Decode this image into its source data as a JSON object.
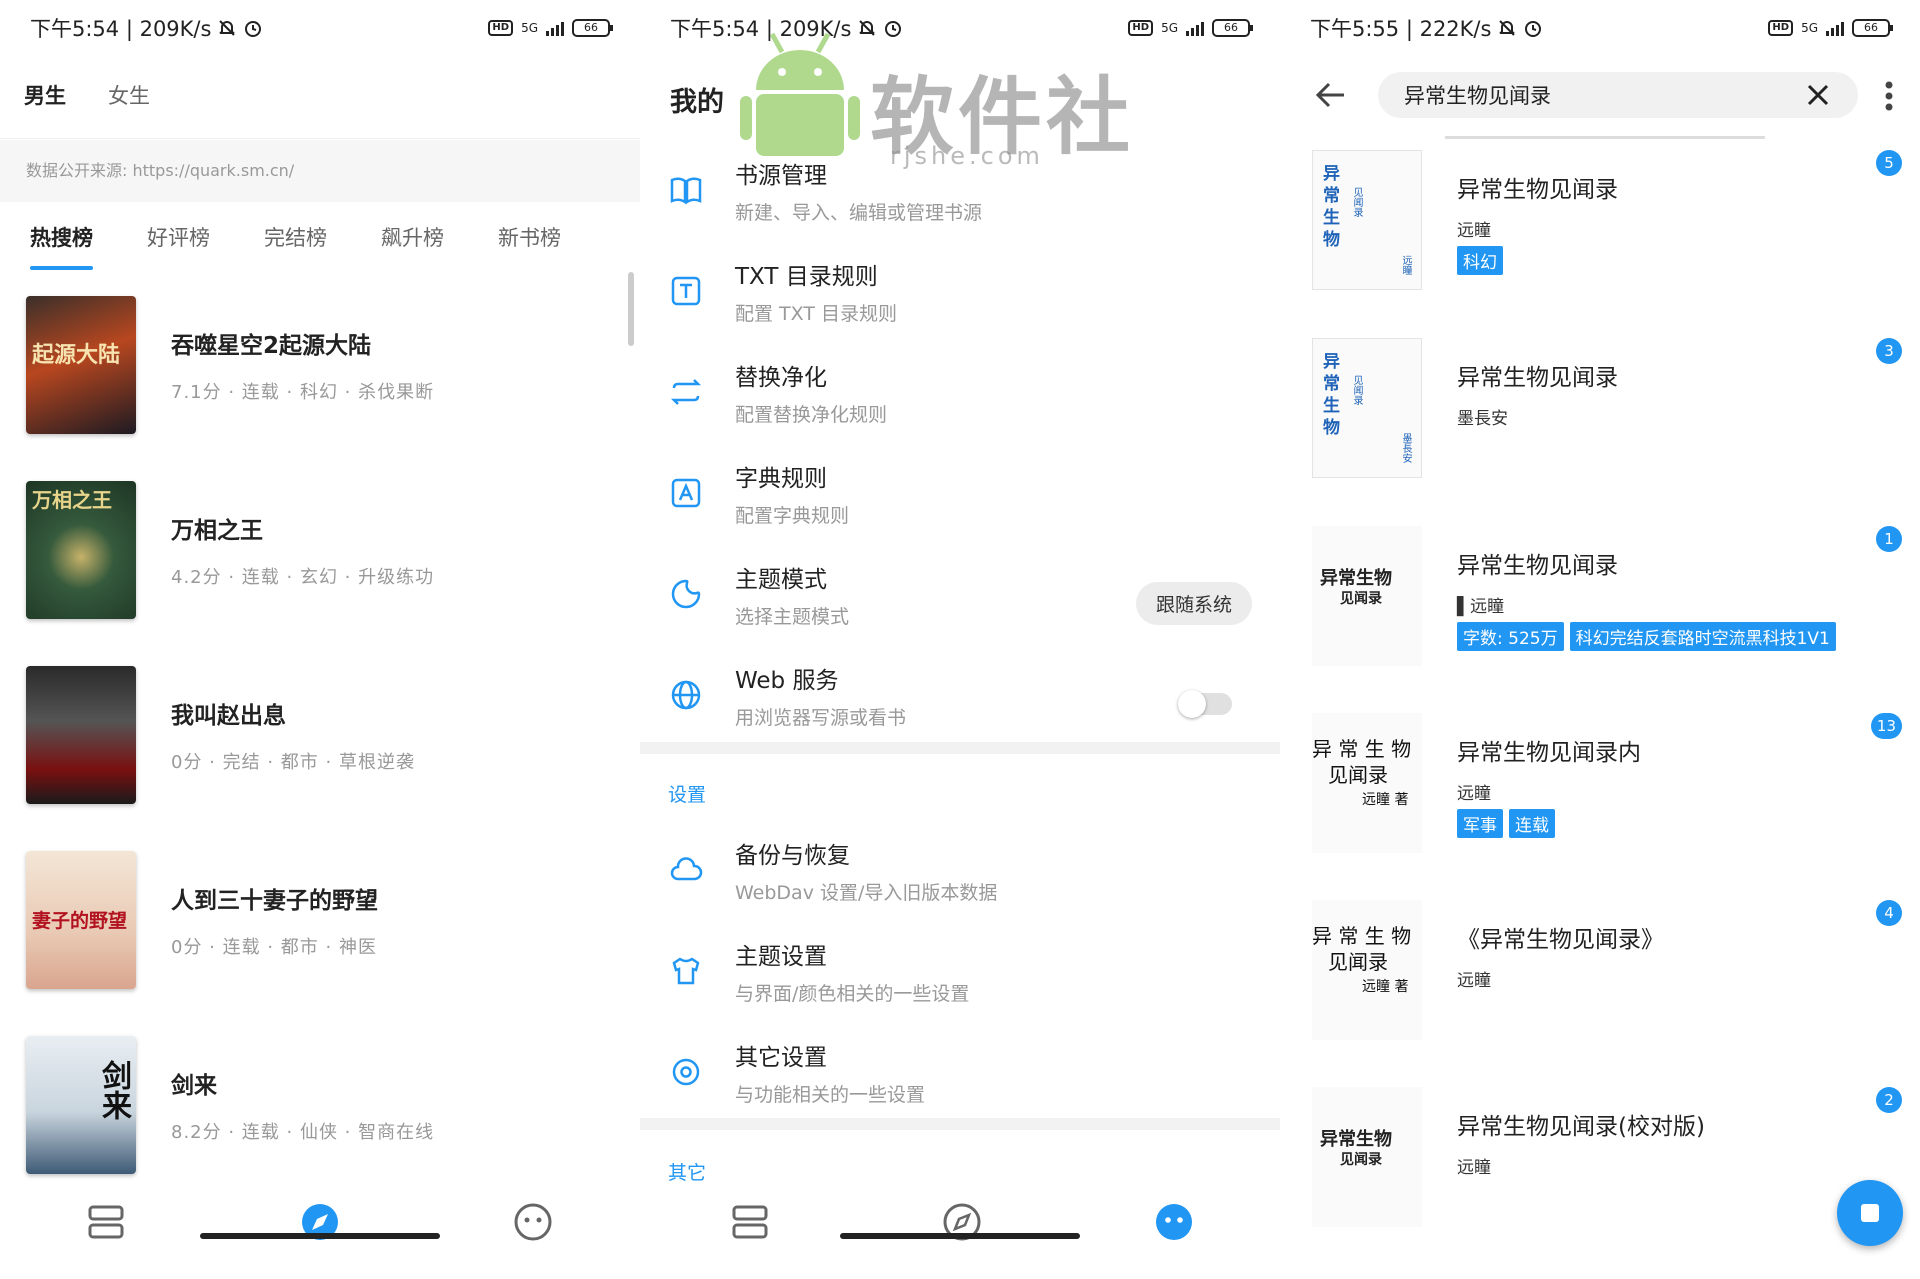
{
  "colors": {
    "accent": "#2196f3",
    "text": "#222222",
    "muted": "#999999"
  },
  "panel1": {
    "status": {
      "time": "下午5:54 | 209K/s",
      "battery": "66",
      "network": "5G"
    },
    "gender_tabs": [
      "男生",
      "女生"
    ],
    "data_source": "数据公开来源: https://quark.sm.cn/",
    "rank_tabs": [
      "热搜榜",
      "好评榜",
      "完结榜",
      "飙升榜",
      "新书榜"
    ],
    "books": [
      {
        "title": "吞噬星空2起源大陆",
        "meta": "7.1分 · 连载 · 科幻 · 杀伐果断",
        "cover_text": "起源大陆"
      },
      {
        "title": "万相之王",
        "meta": "4.2分 · 连载 · 玄幻 · 升级练功",
        "cover_text": "万相之王"
      },
      {
        "title": "我叫赵出息",
        "meta": "0分 · 完结 · 都市 · 草根逆袭",
        "cover_text": ""
      },
      {
        "title": "人到三十妻子的野望",
        "meta": "0分 · 连载 · 都市 · 神医",
        "cover_text": "妻子的野望"
      },
      {
        "title": "剑来",
        "meta": "8.2分 · 连载 · 仙侠 · 智商在线",
        "cover_text": "剑来"
      }
    ],
    "nav": [
      "bookshelf-icon",
      "explore-icon",
      "my-icon"
    ]
  },
  "panel2": {
    "status": {
      "time": "下午5:54 | 209K/s",
      "battery": "66",
      "network": "5G"
    },
    "title": "我的",
    "watermark": {
      "text": "软件社",
      "url": "rjshe.com"
    },
    "items_top": [
      {
        "title": "书源管理",
        "desc": "新建、导入、编辑或管理书源",
        "icon": "book-open-icon"
      },
      {
        "title": "TXT 目录规则",
        "desc": "配置 TXT 目录规则",
        "icon": "txt-icon"
      },
      {
        "title": "替换净化",
        "desc": "配置替换净化规则",
        "icon": "replace-icon"
      },
      {
        "title": "字典规则",
        "desc": "配置字典规则",
        "icon": "dictionary-icon"
      },
      {
        "title": "主题模式",
        "desc": "选择主题模式",
        "icon": "theme-mode-icon",
        "chip": "跟随系统"
      },
      {
        "title": "Web 服务",
        "desc": "用浏览器写源或看书",
        "icon": "globe-icon",
        "toggle": false
      }
    ],
    "section_settings": "设置",
    "items_settings": [
      {
        "title": "备份与恢复",
        "desc": "WebDav 设置/导入旧版本数据",
        "icon": "cloud-icon"
      },
      {
        "title": "主题设置",
        "desc": "与界面/颜色相关的一些设置",
        "icon": "shirt-icon"
      },
      {
        "title": "其它设置",
        "desc": "与功能相关的一些设置",
        "icon": "settings-icon"
      }
    ],
    "section_other": "其它"
  },
  "panel3": {
    "status": {
      "time": "下午5:55 | 222K/s",
      "battery": "66",
      "network": "5G"
    },
    "search": {
      "value": "异常生物见闻录"
    },
    "results": [
      {
        "title": "异常生物见闻录",
        "author": "远瞳",
        "tags": [
          "科幻"
        ],
        "count": "5"
      },
      {
        "title": "异常生物见闻录",
        "author": "墨長安",
        "tags": [],
        "count": "3"
      },
      {
        "title": "异常生物见闻录",
        "author": "▌远瞳",
        "tags": [
          "字数: 525万",
          "科幻完结反套路时空流黑科技1V1"
        ],
        "count": "1"
      },
      {
        "title": "异常生物见闻录内",
        "author": "远瞳",
        "tags": [
          "军事",
          "连载"
        ],
        "count": "13"
      },
      {
        "title": "《异常生物见闻录》",
        "author": "远瞳",
        "tags": [],
        "count": "4"
      },
      {
        "title": "异常生物见闻录(校对版)",
        "author": "远瞳",
        "tags": [],
        "count": "2"
      }
    ],
    "covers": [
      {
        "lines": [
          "异",
          "常",
          "生",
          "物"
        ],
        "sub": "见闻录",
        "author": "远瞳"
      },
      {
        "lines": [
          "异",
          "常",
          "生",
          "物"
        ],
        "sub": "见闻录",
        "author": "墨長安"
      },
      {
        "lines": [
          "异常生物"
        ],
        "sub": "见闻录",
        "author": ""
      },
      {
        "lines": [
          "异 常 生 物"
        ],
        "sub": "见闻录",
        "author": "远瞳 著"
      },
      {
        "lines": [
          "异 常 生 物"
        ],
        "sub": "见闻录",
        "author": "远瞳 著"
      },
      {
        "lines": [
          "异常生物"
        ],
        "sub": "见闻录",
        "author": ""
      }
    ]
  }
}
